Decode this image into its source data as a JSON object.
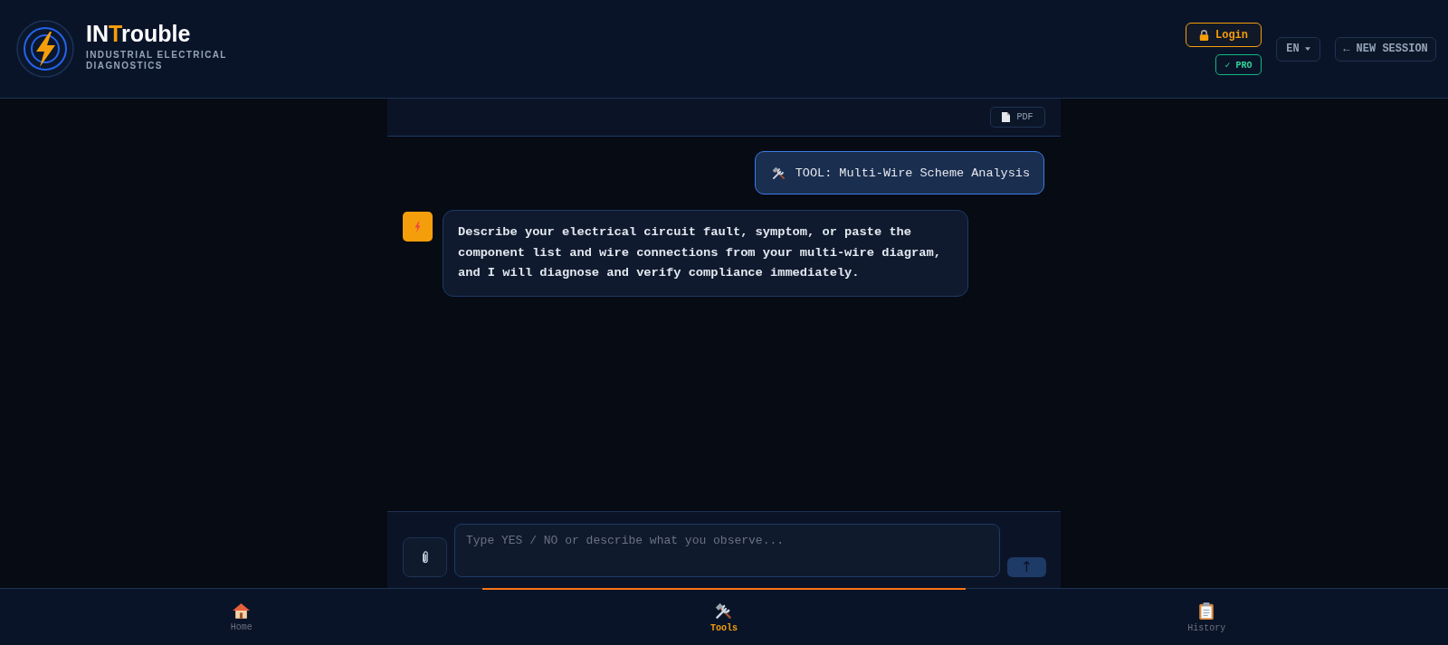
{
  "header": {
    "brand": {
      "title_start": "IN",
      "title_accent": "T",
      "title_end": "rouble",
      "subtitle": "INDUSTRIAL ELECTRICAL DIAGNOSTICS"
    },
    "login": {
      "label": "Login"
    },
    "plan_badge": {
      "label": "✓ PRO"
    },
    "language": {
      "label": "EN"
    },
    "new_session": {
      "label": "← NEW SESSION"
    }
  },
  "chat": {
    "toolbar": {
      "export": {
        "label": "PDF"
      }
    },
    "messages": [
      {
        "kind": "user",
        "text": "TOOL: Multi-Wire Scheme Analysis"
      },
      {
        "kind": "assistant",
        "text": "Describe your electrical circuit fault, symptom, or paste the component list and wire connections from your multi-wire diagram, and I will diagnose and verify compliance immediately."
      }
    ],
    "composer": {
      "placeholder": "Type YES / NO or describe what you observe...",
      "send": {
        "label": "↑"
      }
    }
  },
  "nav": {
    "items": [
      {
        "label": "Home",
        "selected": false
      },
      {
        "label": "Tools",
        "selected": true
      },
      {
        "label": "History",
        "selected": false
      }
    ]
  }
}
